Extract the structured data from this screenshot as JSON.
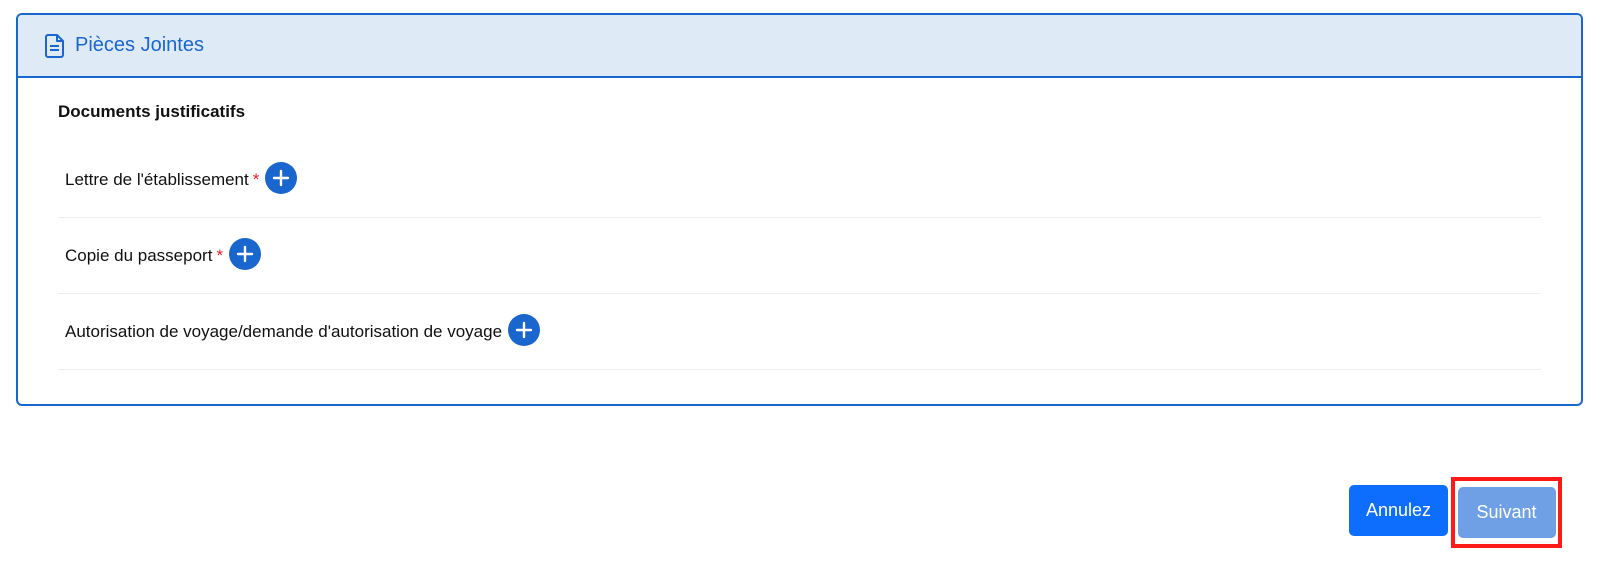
{
  "panel": {
    "title": "Pièces Jointes",
    "icon": "document-icon",
    "accent_color": "#1a66cf",
    "header_bg": "#deebf7"
  },
  "section": {
    "title": "Documents justificatifs"
  },
  "documents": [
    {
      "label": "Lettre de l'établissement",
      "required_mark": "*",
      "add_icon": "plus-icon"
    },
    {
      "label": "Copie du passeport",
      "required_mark": "*",
      "add_icon": "plus-icon"
    },
    {
      "label": "Autorisation de voyage/demande d'autorisation de voyage",
      "required_mark": "",
      "add_icon": "plus-icon"
    }
  ],
  "actions": {
    "cancel_label": "Annulez",
    "next_label": "Suivant",
    "cancel_color": "#0d6efd",
    "next_color": "#6fa0e6",
    "highlight_color": "#ff1a1a"
  }
}
